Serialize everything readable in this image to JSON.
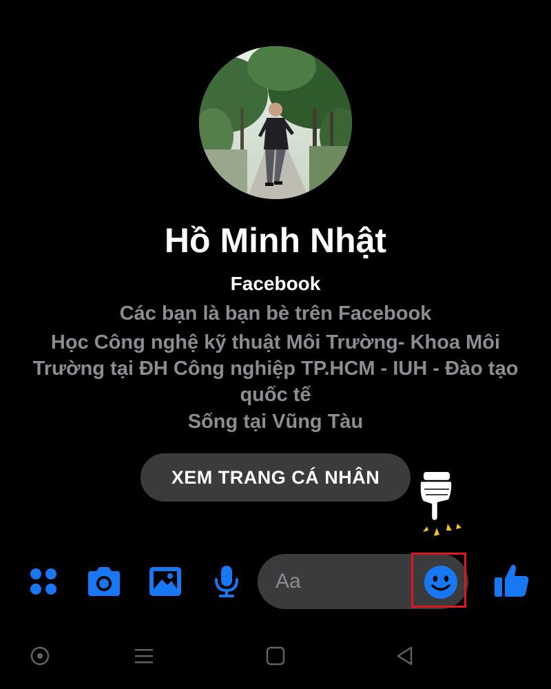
{
  "profile": {
    "name": "Hồ Minh Nhật",
    "source": "Facebook",
    "friends_text": "Các bạn là bạn bè trên Facebook",
    "study_text": "Học Công nghệ kỹ thuật Môi Trường- Khoa Môi Trường tại ĐH Công nghiệp TP.HCM - IUH - Đào tạo quốc tế",
    "location_text": "Sống tại Vũng Tàu",
    "view_profile_label": "XEM TRANG CÁ NHÂN"
  },
  "composer": {
    "placeholder": "Aa",
    "icons": [
      "apps-icon",
      "camera-icon",
      "gallery-icon",
      "microphone-icon",
      "emoji-icon",
      "thumbs-up-icon"
    ]
  },
  "nav_bar": {
    "icons": [
      "home-circle-icon",
      "menu-icon",
      "recents-square-icon",
      "back-triangle-icon"
    ]
  },
  "colors": {
    "background": "#000000",
    "accent": "#1877f2",
    "secondary_text": "#8a8d91",
    "button_bg": "#3a3b3c",
    "highlight": "#e0151d",
    "nav_icon": "#5f6368"
  }
}
